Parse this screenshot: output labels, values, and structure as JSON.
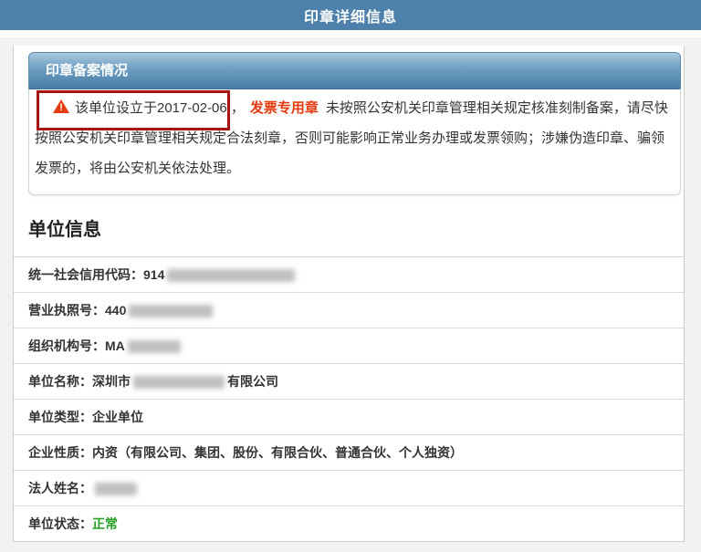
{
  "page_title": "印章详细信息",
  "panel": {
    "header": "印章备案情况",
    "warning": {
      "highlighted_text": "该单位设立于2017-02-06 ，",
      "seal_name": "发票专用章",
      "rest_text": "未按照公安机关印章管理相关规定核准刻制备案，请尽快按照公安机关印章管理相关规定合法刻章，否则可能影响正常业务办理或发票领购；涉嫌伪造印章、骗领发票的，将由公安机关依法处理。"
    }
  },
  "section": {
    "title": "单位信息",
    "rows": [
      {
        "label": "统一社会信用代码：",
        "visible_value": "914",
        "redacted": true
      },
      {
        "label": "营业执照号：",
        "visible_value": "440",
        "redacted": true
      },
      {
        "label": "组织机构号：",
        "visible_value": "MA",
        "redacted": true
      },
      {
        "label": "单位名称：",
        "visible_value": "深圳市",
        "visible_suffix": "有限公司",
        "redacted": true
      },
      {
        "label": "单位类型：",
        "value": "企业单位"
      },
      {
        "label": "企业性质：",
        "value": "内资（有限公司、集团、股份、有限合伙、普通合伙、个人独资）"
      },
      {
        "label": "法人姓名：",
        "visible_value": "",
        "redacted": true
      },
      {
        "label": "单位状态：",
        "value": "正常",
        "status": "normal"
      }
    ]
  },
  "colors": {
    "header_blue": "#4d81ab",
    "panel_gradient_top": "#a9c9df",
    "panel_gradient_bottom": "#497ea8",
    "annotation_red": "#a81414",
    "alert_red": "#e63b11",
    "status_green": "#23a023"
  }
}
